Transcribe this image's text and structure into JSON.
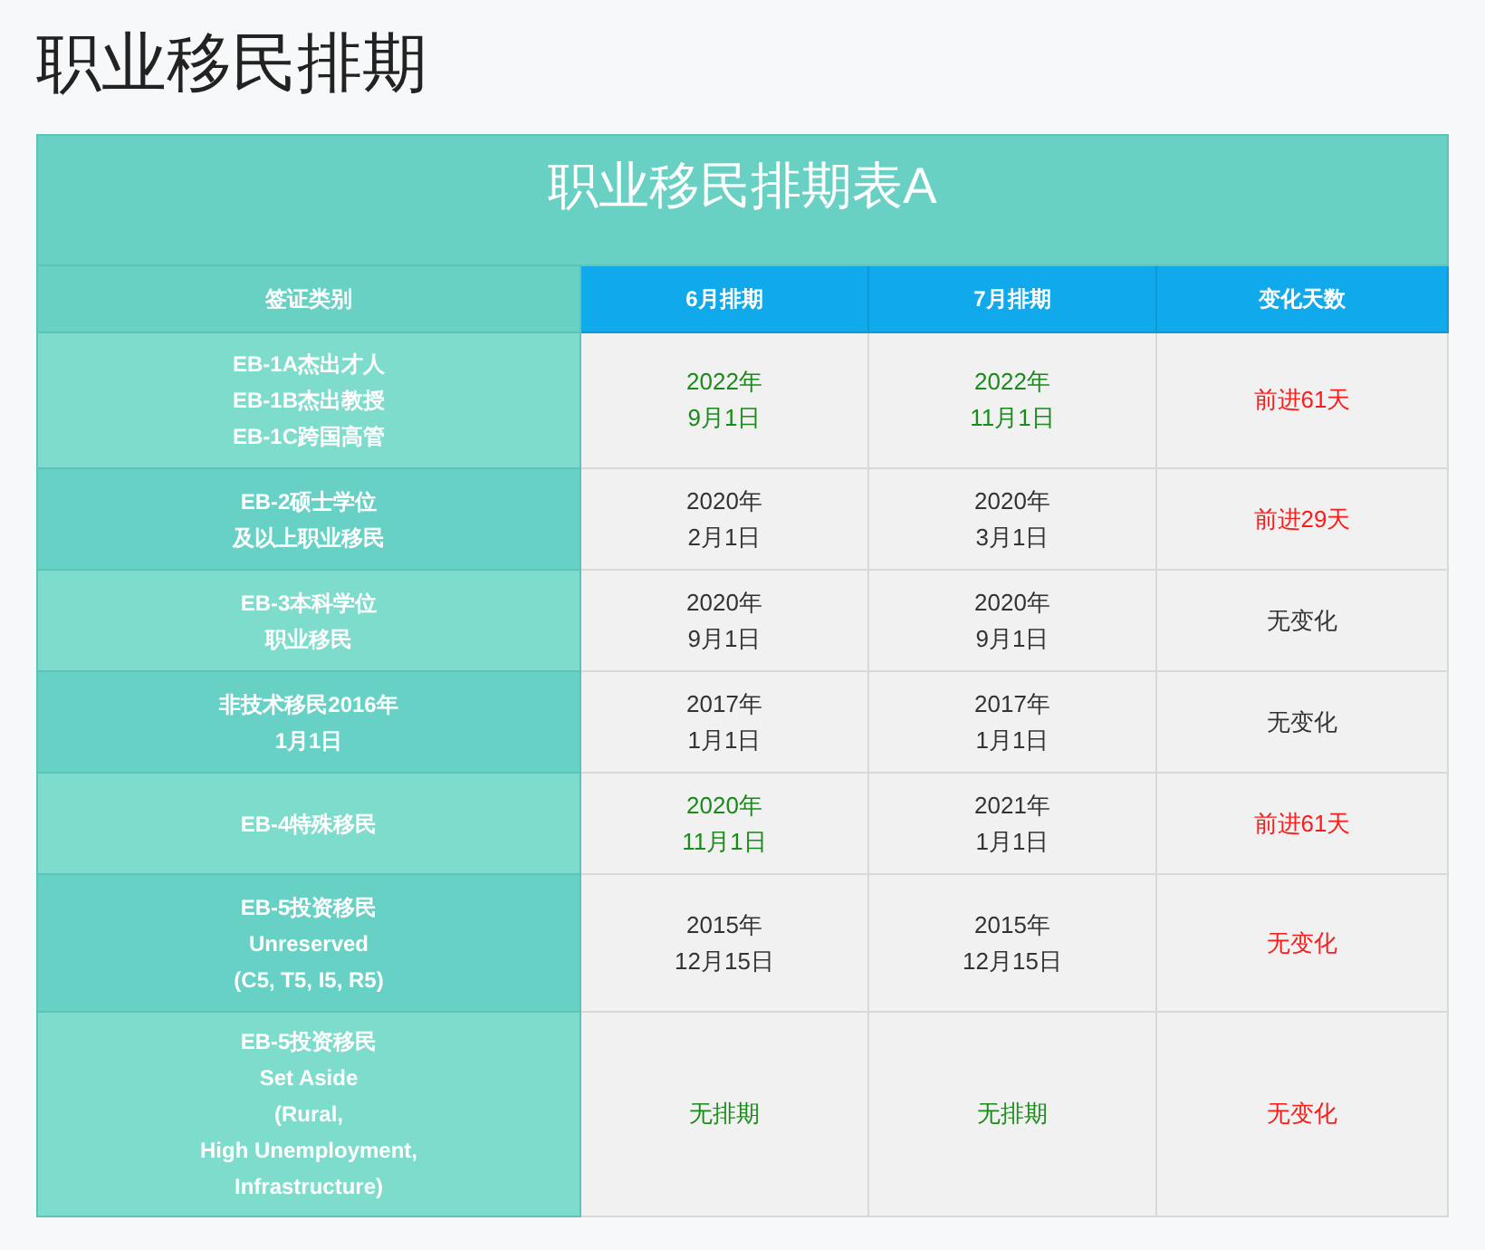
{
  "page_title": "职业移民排期",
  "table": {
    "title": "职业移民排期表A",
    "columns": [
      {
        "label": "签证类别",
        "kind": "category"
      },
      {
        "label": "6月排期",
        "kind": "date"
      },
      {
        "label": "7月排期",
        "kind": "date"
      },
      {
        "label": "变化天数",
        "kind": "date"
      }
    ],
    "rows": [
      {
        "cells": [
          {
            "lines": [
              "EB-1A杰出才人",
              "EB-1B杰出教授",
              "EB-1C跨国高管"
            ]
          },
          {
            "lines": [
              "2022年",
              "9月1日"
            ],
            "color": "#1a8a1a"
          },
          {
            "lines": [
              "2022年",
              "11月1日"
            ],
            "color": "#1a8a1a"
          },
          {
            "lines": [
              "前进61天"
            ],
            "color": "#ff1a1a"
          }
        ]
      },
      {
        "cells": [
          {
            "lines": [
              "EB-2硕士学位",
              "及以上职业移民"
            ]
          },
          {
            "lines": [
              "2020年",
              "2月1日"
            ],
            "color": "#333333"
          },
          {
            "lines": [
              "2020年",
              "3月1日"
            ],
            "color": "#333333"
          },
          {
            "lines": [
              "前进29天"
            ],
            "color": "#ff1a1a"
          }
        ]
      },
      {
        "cells": [
          {
            "lines": [
              "EB-3本科学位",
              "职业移民"
            ]
          },
          {
            "lines": [
              "2020年",
              "9月1日"
            ],
            "color": "#333333"
          },
          {
            "lines": [
              "2020年",
              "9月1日"
            ],
            "color": "#333333"
          },
          {
            "lines": [
              "无变化"
            ],
            "color": "#333333"
          }
        ]
      },
      {
        "cells": [
          {
            "lines": [
              "非技术移民2016年",
              "1月1日"
            ]
          },
          {
            "lines": [
              "2017年",
              "1月1日"
            ],
            "color": "#333333"
          },
          {
            "lines": [
              "2017年",
              "1月1日"
            ],
            "color": "#333333"
          },
          {
            "lines": [
              "无变化"
            ],
            "color": "#333333"
          }
        ]
      },
      {
        "cells": [
          {
            "lines": [
              "EB-4特殊移民"
            ]
          },
          {
            "lines": [
              "2020年",
              "11月1日"
            ],
            "color": "#1a8a1a"
          },
          {
            "lines": [
              "2021年",
              "1月1日"
            ],
            "color": "#333333"
          },
          {
            "lines": [
              "前进61天"
            ],
            "color": "#ff1a1a"
          }
        ]
      },
      {
        "cells": [
          {
            "lines": [
              "EB-5投资移民",
              "Unreserved",
              "(C5, T5, I5, R5)"
            ]
          },
          {
            "lines": [
              "2015年",
              "12月15日"
            ],
            "color": "#333333"
          },
          {
            "lines": [
              "2015年",
              "12月15日"
            ],
            "color": "#333333"
          },
          {
            "lines": [
              "无变化"
            ],
            "color": "#ff1a1a"
          }
        ]
      },
      {
        "cells": [
          {
            "lines": [
              "EB-5投资移民",
              "Set Aside",
              "(Rural,",
              "High Unemployment,",
              "Infrastructure)"
            ]
          },
          {
            "lines": [
              "无排期"
            ],
            "color": "#1a8a1a"
          },
          {
            "lines": [
              "无排期"
            ],
            "color": "#1a8a1a"
          },
          {
            "lines": [
              "无变化"
            ],
            "color": "#ff1a1a"
          }
        ]
      }
    ]
  }
}
